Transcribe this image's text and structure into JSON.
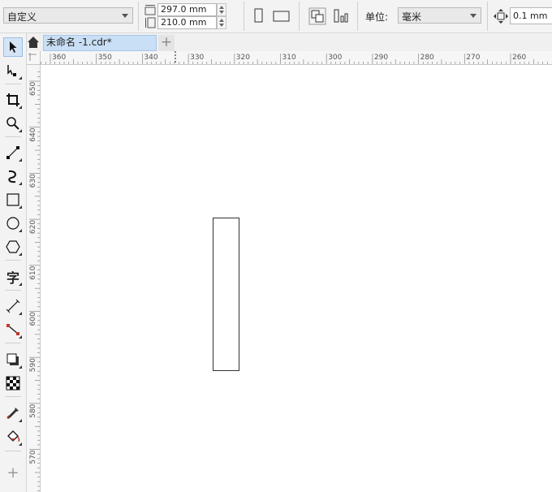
{
  "toolbar": {
    "page_preset": "自定义",
    "page_width": "297.0 mm",
    "page_height": "210.0 mm",
    "unit_label": "单位:",
    "unit_value": "毫米",
    "nudge_value": "0.1 mm"
  },
  "tabs": {
    "document_tab": "未命名 -1.cdr*",
    "add_tab": "+"
  },
  "ruler": {
    "horizontal_ticks": [
      "360",
      "350",
      "340",
      "330",
      "320",
      "310",
      "300",
      "290",
      "280",
      "270",
      "260"
    ],
    "vertical_ticks": [
      "650",
      "640",
      "630",
      "620",
      "610",
      "600",
      "590",
      "580",
      "570"
    ],
    "corner_label": "毫米"
  },
  "tools": [
    "pick-tool",
    "freehand-pick-tool",
    "crop-tool",
    "zoom-tool",
    "freehand-tool",
    "artistic-media-tool",
    "rectangle-tool",
    "ellipse-tool",
    "polygon-tool",
    "text-tool",
    "parallel-dimension-tool",
    "connector-tool",
    "drop-shadow-tool",
    "transparency-tool",
    "eyedropper-tool",
    "interactive-fill-tool",
    "add-tool"
  ],
  "colors": {
    "selected_tool_bg": "#d4e4f5",
    "tab_active_bg": "#c9dff5",
    "canvas_bg": "#ffffff"
  }
}
